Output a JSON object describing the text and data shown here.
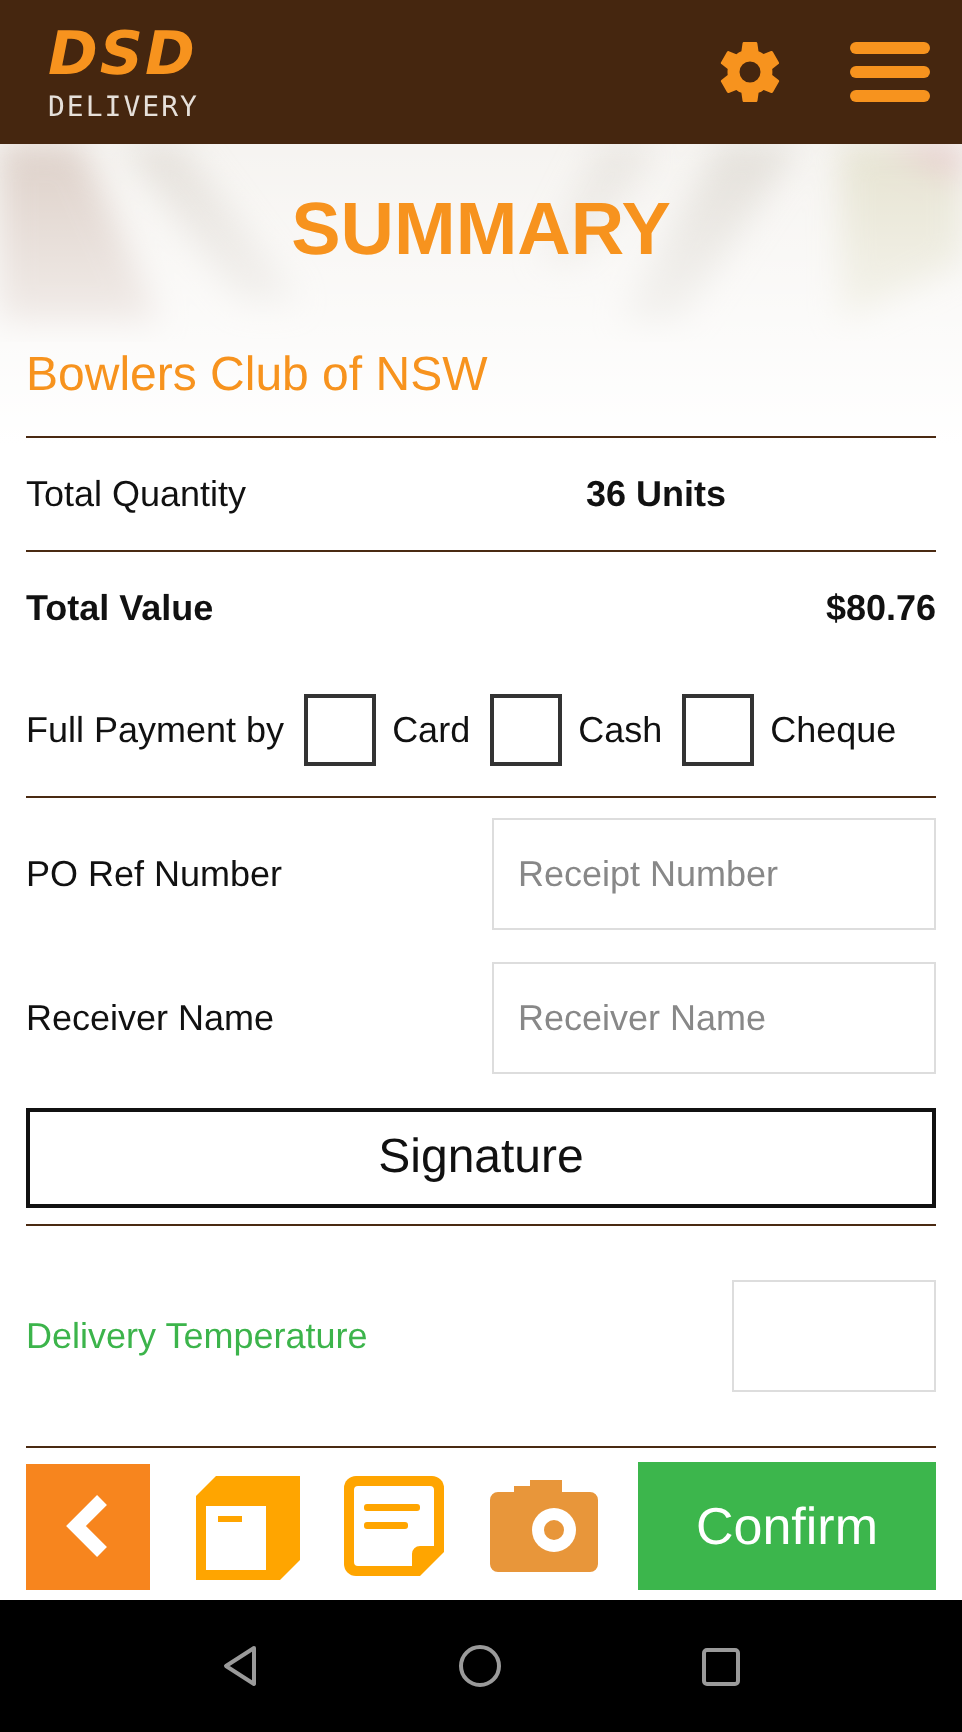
{
  "header": {
    "logo_mark": "DSD",
    "logo_text": "DELIVERY"
  },
  "title": "SUMMARY",
  "customer": "Bowlers Club of NSW",
  "totals": [
    {
      "kind": "quantity",
      "label": "Total Quantity",
      "value": "36 Units"
    },
    {
      "kind": "value",
      "label": "Total Value",
      "value": "$80.76"
    }
  ],
  "payment": {
    "label": "Full Payment by",
    "options": [
      {
        "label": "Card",
        "checked": false
      },
      {
        "label": "Cash",
        "checked": false
      },
      {
        "label": "Cheque",
        "checked": false
      }
    ]
  },
  "fields": [
    {
      "label": "PO Ref Number",
      "placeholder": "Receipt Number"
    },
    {
      "label": "Receiver Name",
      "placeholder": "Receiver Name"
    }
  ],
  "signature_button": "Signature",
  "temperature": {
    "label": "Delivery Temperature"
  },
  "confirm_button": "Confirm"
}
